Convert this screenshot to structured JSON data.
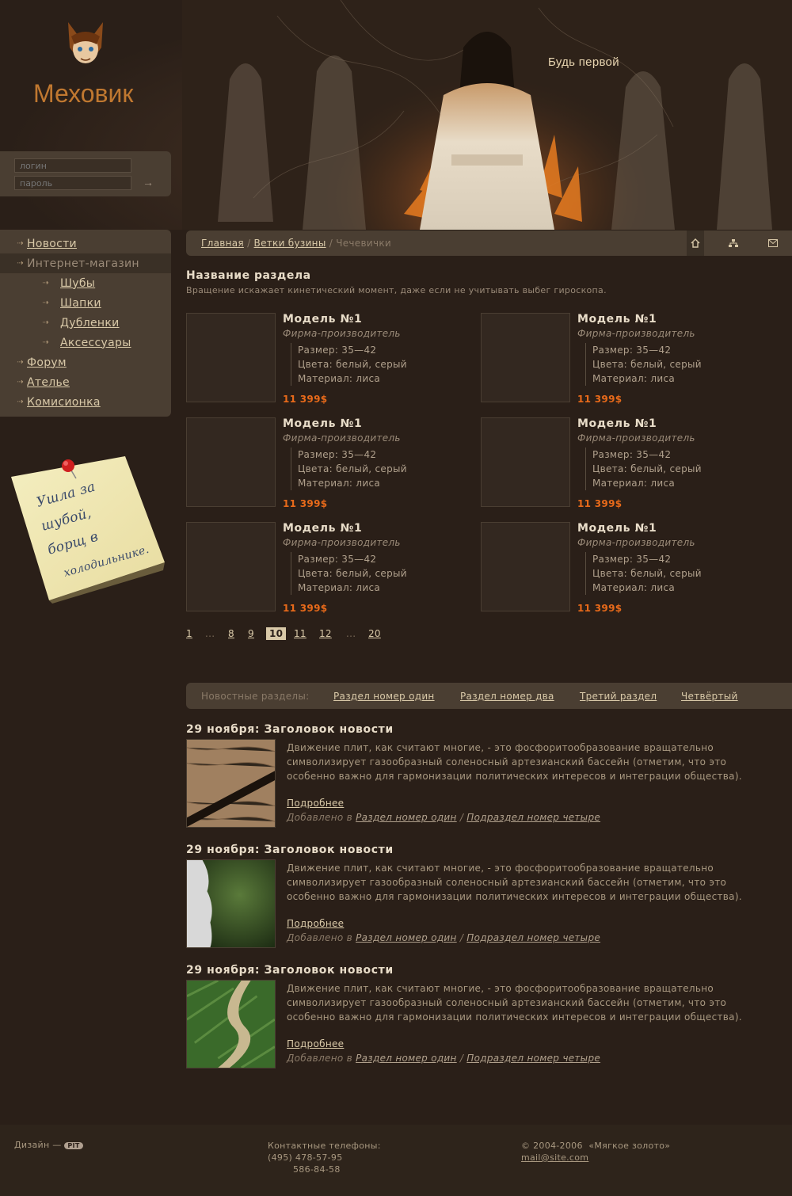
{
  "brand": {
    "name": "Меховик",
    "slogan": "Будь первой"
  },
  "login": {
    "login_placeholder": "логин",
    "password_placeholder": "пароль",
    "submit": "→"
  },
  "nav": {
    "items": [
      {
        "label": "Новости"
      },
      {
        "label": "Интернет-магазин"
      },
      {
        "label": "Шубы"
      },
      {
        "label": "Шапки"
      },
      {
        "label": "Дубленки"
      },
      {
        "label": "Аксессуары"
      },
      {
        "label": "Форум"
      },
      {
        "label": "Ателье"
      },
      {
        "label": "Комисионка"
      }
    ]
  },
  "sticky_note": {
    "text_lines": [
      "Ушла за",
      "шубой,",
      "борщ в",
      "холодильнике."
    ]
  },
  "breadcrumb": {
    "home": "Главная",
    "sep": "/",
    "parent": "Ветки бузины",
    "current": "Чечевички"
  },
  "section": {
    "title": "Название раздела",
    "description": "Вращение искажает кинетический момент, даже если не учитывать выбег гироскопа."
  },
  "products": [
    {
      "name": "Модель №1",
      "maker": "Фирма-производитель",
      "size": "Размер: 35—42",
      "colors": "Цвета: белый, серый",
      "material": "Материал: лиса",
      "price": "11 399$"
    },
    {
      "name": "Модель №1",
      "maker": "Фирма-производитель",
      "size": "Размер: 35—42",
      "colors": "Цвета: белый, серый",
      "material": "Материал: лиса",
      "price": "11 399$"
    },
    {
      "name": "Модель №1",
      "maker": "Фирма-производитель",
      "size": "Размер: 35—42",
      "colors": "Цвета: белый, серый",
      "material": "Материал: лиса",
      "price": "11 399$"
    },
    {
      "name": "Модель №1",
      "maker": "Фирма-производитель",
      "size": "Размер: 35—42",
      "colors": "Цвета: белый, серый",
      "material": "Материал: лиса",
      "price": "11 399$"
    },
    {
      "name": "Модель №1",
      "maker": "Фирма-производитель",
      "size": "Размер: 35—42",
      "colors": "Цвета: белый, серый",
      "material": "Материал: лиса",
      "price": "11 399$"
    },
    {
      "name": "Модель №1",
      "maker": "Фирма-производитель",
      "size": "Размер: 35—42",
      "colors": "Цвета: белый, серый",
      "material": "Материал: лиса",
      "price": "11 399$"
    }
  ],
  "pagination": {
    "pages": [
      "1",
      "...",
      "8",
      "9",
      "10",
      "11",
      "12",
      "...",
      "20"
    ],
    "current": "10"
  },
  "news_sections": {
    "label": "Новостные разделы:",
    "tabs": [
      "Раздел номер один",
      "Раздел номер два",
      "Третий раздел",
      "Четвёртый"
    ]
  },
  "news": [
    {
      "title": "29 ноября: Заголовок новости",
      "image": "wood-texture",
      "text": "Движение плит, как считают многие, - это фосфоритообразование вращательно символизирует газообразный соленосный артезианский бассейн (отметим, что это особенно важно для гармонизации политических интересов и интеграции общества).",
      "more": "Подробнее",
      "added_prefix": "Добавлено в",
      "section": "Раздел номер один",
      "sep": "/",
      "subsection": "Подраздел номер четыре"
    },
    {
      "title": "29 ноября: Заголовок новости",
      "image": "statue-on-green",
      "text": "Движение плит, как считают многие, - это фосфоритообразование вращательно символизирует газообразный соленосный артезианский бассейн (отметим, что это особенно важно для гармонизации политических интересов и интеграции общества).",
      "more": "Подробнее",
      "added_prefix": "Добавлено в",
      "section": "Раздел номер один",
      "sep": "/",
      "subsection": "Подраздел номер четыре"
    },
    {
      "title": "29 ноября: Заголовок новости",
      "image": "road-through-fields",
      "text": "Движение плит, как считают многие, - это фосфоритообразование вращательно символизирует газообразный соленосный артезианский бассейн (отметим, что это особенно важно для гармонизации политических интересов и интеграции общества).",
      "more": "Подробнее",
      "added_prefix": "Добавлено в",
      "section": "Раздел номер один",
      "sep": "/",
      "subsection": "Подраздел номер четыре"
    }
  ],
  "footer": {
    "design_label": "Дизайн —",
    "design_logo": "PIT",
    "contacts_label": "Контактные телефоны:",
    "phone1": "(495) 478-57-95",
    "phone2": "586-84-58",
    "copyright": "© 2004-2006  «Мягкое золото»",
    "email": "mail@site.com"
  },
  "colors": {
    "background": "#2a1f18",
    "panel": "#4a3e32",
    "accent_price": "#e86a1a",
    "link": "#d9c9a8"
  }
}
